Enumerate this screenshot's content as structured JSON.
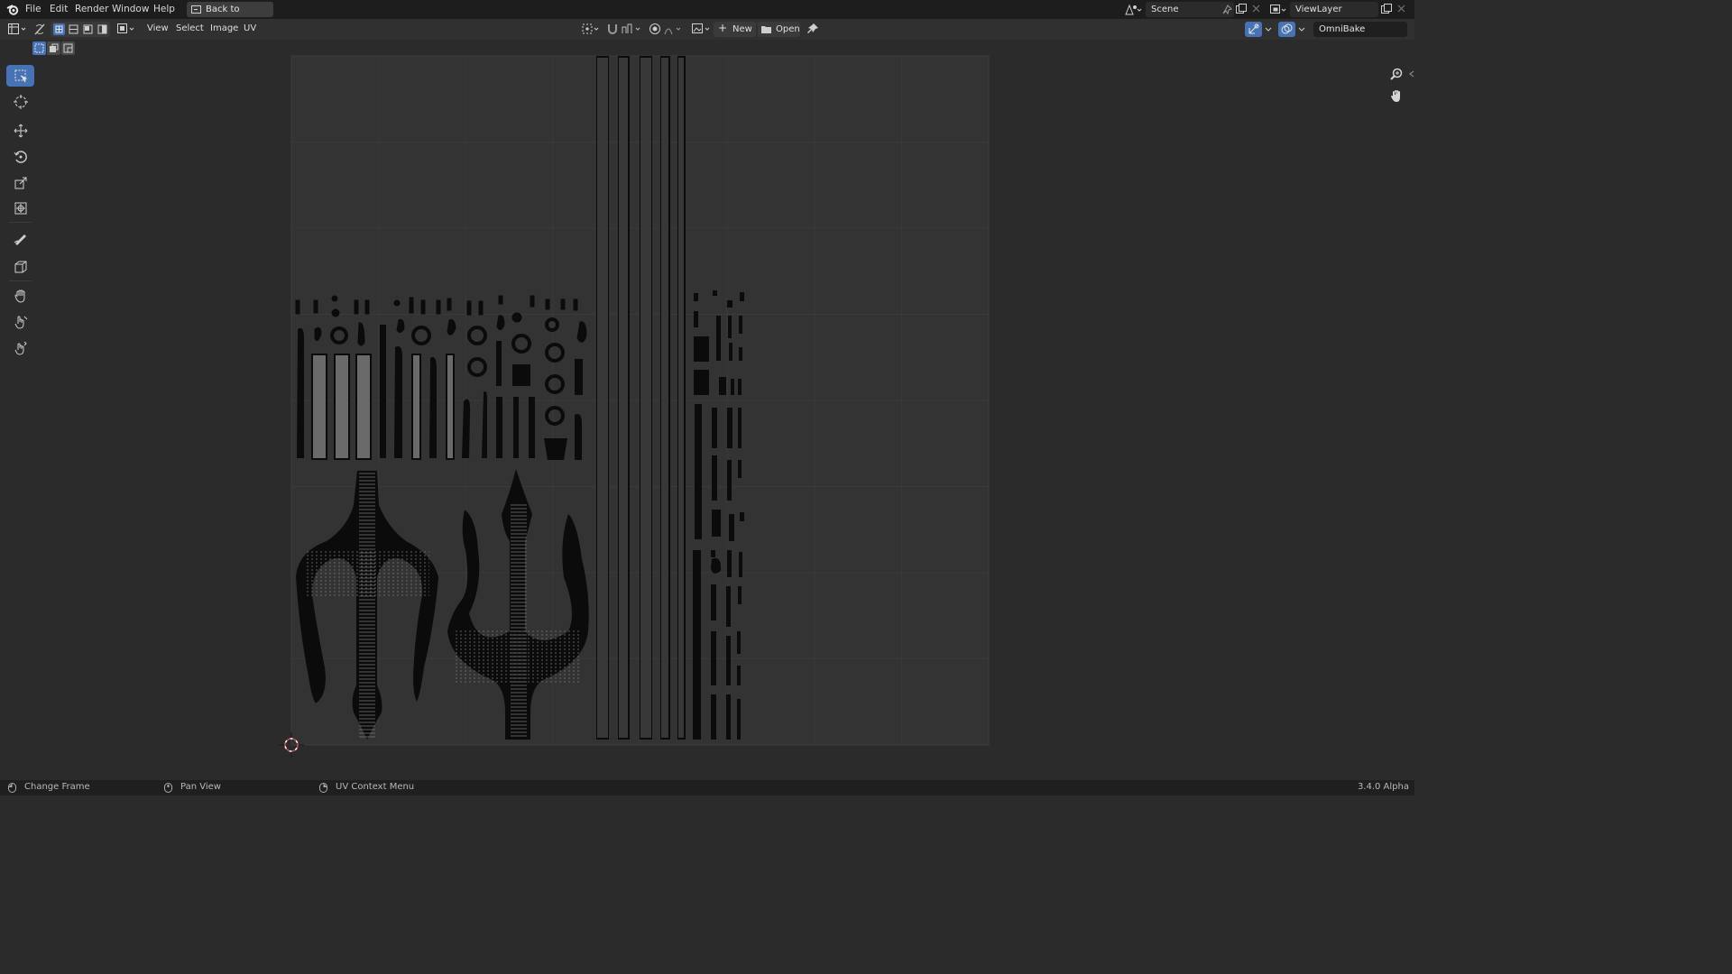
{
  "menu": {
    "items": [
      "File",
      "Edit",
      "Render",
      "Window",
      "Help"
    ],
    "back_button": "Back to Previous"
  },
  "scene": {
    "name": "Scene"
  },
  "view_layer": {
    "name": "ViewLayer"
  },
  "header": {
    "menus": [
      "View",
      "Select",
      "Image",
      "UV"
    ],
    "new_label": "New",
    "open_label": "Open",
    "workspace_field": "OmniBake"
  },
  "toolbar": {
    "tools": [
      "select-box",
      "cursor",
      "move",
      "rotate",
      "scale",
      "transform",
      "annotate",
      "rip-region",
      "grab",
      "relax",
      "pinch"
    ],
    "active_tool": "select-box"
  },
  "navigation": {
    "icons": [
      "zoom-icon",
      "pan-hand-icon"
    ]
  },
  "status": {
    "left_click": "Change Frame",
    "middle_click": "Pan View",
    "right_click": "UV Context Menu",
    "version": "3.4.0 Alpha"
  },
  "colors": {
    "accent": "#4772b3",
    "background": "#2b2b2b",
    "uv_canvas": "#333333",
    "uv_islands": "#0b0b0b"
  }
}
